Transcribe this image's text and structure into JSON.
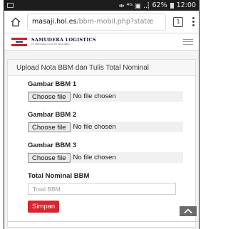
{
  "status_bar": {
    "indicators": "⇹ ⁴ᴳ ▣ ..⸽",
    "battery": "62%",
    "time": "12:00"
  },
  "browser": {
    "url_host": "masaji.hol.es",
    "url_path": "/bbm-mobil.php?statæ",
    "tab_count": "1"
  },
  "site": {
    "logo_name": "SAMUDERA LOGISTICS",
    "logo_tagline": "PT SAMUDERA LOGISTIK INDONESIA"
  },
  "form": {
    "heading": "Upload Nota BBM dan Tulis Total Nominal",
    "fields": [
      {
        "label": "Gambar BBM 1",
        "button": "Choose file",
        "status": "No file chosen"
      },
      {
        "label": "Gambar BBM 2",
        "button": "Choose file",
        "status": "No file chosen"
      },
      {
        "label": "Gambar BBM 3",
        "button": "Choose file",
        "status": "No file chosen"
      }
    ],
    "total_label": "Total Nominal BBM",
    "total_placeholder": "Total BBM",
    "submit_label": "Simpan"
  },
  "colors": {
    "accent": "#d9262e",
    "brand_blue": "#1e3a8a"
  }
}
